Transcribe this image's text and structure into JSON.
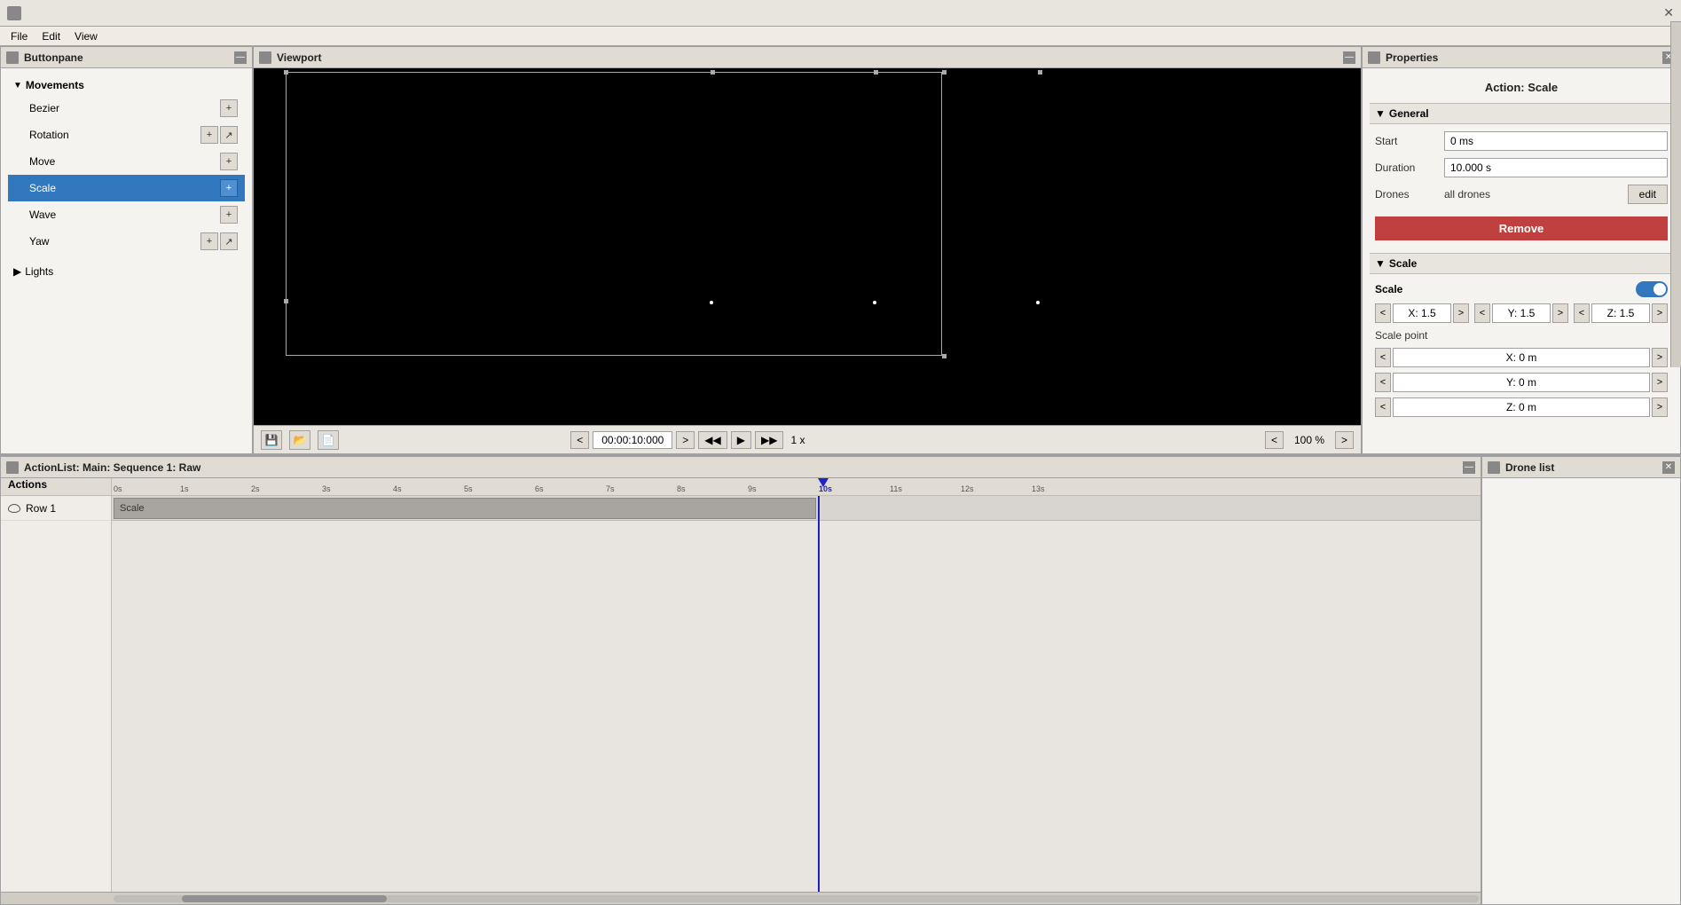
{
  "titlebar": {
    "title": "",
    "close": "✕"
  },
  "menubar": {
    "items": [
      "File",
      "Edit",
      "View"
    ]
  },
  "left_panel": {
    "title": "Buttonpane",
    "movements_group": {
      "label": "Movements",
      "items": [
        {
          "name": "Bezier",
          "has_expand": false,
          "active": false,
          "btns": [
            "+"
          ]
        },
        {
          "name": "Rotation",
          "has_expand": true,
          "active": false,
          "btns": [
            "+",
            "↗"
          ]
        },
        {
          "name": "Move",
          "has_expand": false,
          "active": false,
          "btns": [
            "+"
          ]
        },
        {
          "name": "Scale",
          "has_expand": false,
          "active": true,
          "btns": [
            "+"
          ]
        },
        {
          "name": "Wave",
          "has_expand": false,
          "active": false,
          "btns": [
            "+"
          ]
        },
        {
          "name": "Yaw",
          "has_expand": true,
          "active": false,
          "btns": [
            "+",
            "↗"
          ]
        }
      ]
    },
    "lights_group": {
      "label": "Lights"
    }
  },
  "viewport": {
    "title": "Viewport",
    "time": "00:00:10:000",
    "speed": "1 x",
    "zoom": "100 %"
  },
  "properties": {
    "title": "Properties",
    "action_title": "Action: Scale",
    "general_section": "General",
    "start_label": "Start",
    "start_value": "0 ms",
    "duration_label": "Duration",
    "duration_value": "10.000 s",
    "drones_label": "Drones",
    "drones_value": "all drones",
    "edit_label": "edit",
    "remove_label": "Remove",
    "scale_section": "Scale",
    "scale_label": "Scale",
    "x_value": "X: 1.5",
    "y_value": "Y: 1.5",
    "z_value": "Z: 1.5",
    "scale_point_label": "Scale point",
    "sp_x": "X: 0 m",
    "sp_y": "Y: 0 m",
    "sp_z": "Z: 0 m"
  },
  "actionlist": {
    "title": "ActionList: Main: Sequence 1: Raw",
    "actions_header": "Actions",
    "row1_label": "Row 1",
    "scale_block": "Scale"
  },
  "drone_list": {
    "title": "Drone list"
  },
  "timeline": {
    "ticks": [
      "0s",
      "1s",
      "2s",
      "3s",
      "4s",
      "5s",
      "6s",
      "7s",
      "8s",
      "9s",
      "10s",
      "11s",
      "12s",
      "13s"
    ]
  }
}
